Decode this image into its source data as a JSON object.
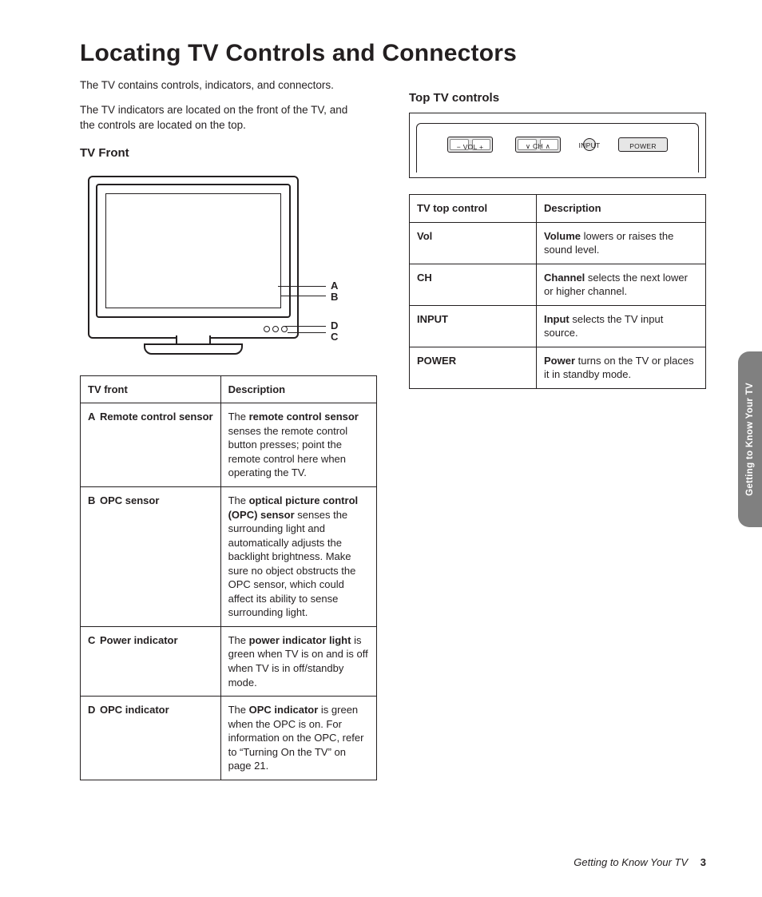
{
  "title": "Locating TV Controls and Connectors",
  "intro": {
    "p1": "The TV contains controls, indicators, and connectors.",
    "p2": "The TV indicators are located on the front of the TV, and the controls are located on the top."
  },
  "side_tab": "Getting to Know Your TV",
  "footer": {
    "section": "Getting to Know Your TV",
    "page": "3"
  },
  "left": {
    "heading": "TV Front",
    "labels": {
      "A": "A",
      "B": "B",
      "C": "C",
      "D": "D"
    },
    "table": {
      "head": {
        "c1": "TV front",
        "c2": "Description"
      },
      "rows": [
        {
          "letter": "A",
          "name": "Remote control sensor",
          "bold": "remote control sensor",
          "pre": "The ",
          "post": " senses the remote control button presses; point the remote control here when operating the TV."
        },
        {
          "letter": "B",
          "name": "OPC sensor",
          "bold": "optical picture control (OPC) sensor",
          "pre": "The ",
          "post": " senses the surrounding light and automatically adjusts the backlight brightness. Make sure no object obstructs the OPC sensor, which could affect its ability to sense surrounding light."
        },
        {
          "letter": "C",
          "name": "Power indicator",
          "bold": "power indicator light",
          "pre": "The ",
          "post": " is green when TV is on and is off when TV is in off/standby mode."
        },
        {
          "letter": "D",
          "name": "OPC indicator",
          "bold": "OPC indicator",
          "pre": "The ",
          "post": " is green when the OPC is on. For information on the OPC, refer to “Turning On the TV” on page 21."
        }
      ]
    }
  },
  "right": {
    "heading": "Top TV controls",
    "panel": {
      "vol": "−  VOL  +",
      "ch": "∨  CH  ∧",
      "input": "INPUT",
      "power": "POWER"
    },
    "table": {
      "head": {
        "c1": "TV top control",
        "c2": "Description"
      },
      "rows": [
        {
          "name": "Vol",
          "bold": "Volume",
          "post": " lowers or raises the sound level."
        },
        {
          "name": "CH",
          "bold": "Channel",
          "post": " selects the next lower or higher channel."
        },
        {
          "name": "INPUT",
          "bold": "Input",
          "post": " selects the TV input source."
        },
        {
          "name": "POWER",
          "bold": "Power",
          "post": " turns on the TV or places it in standby mode."
        }
      ]
    }
  }
}
